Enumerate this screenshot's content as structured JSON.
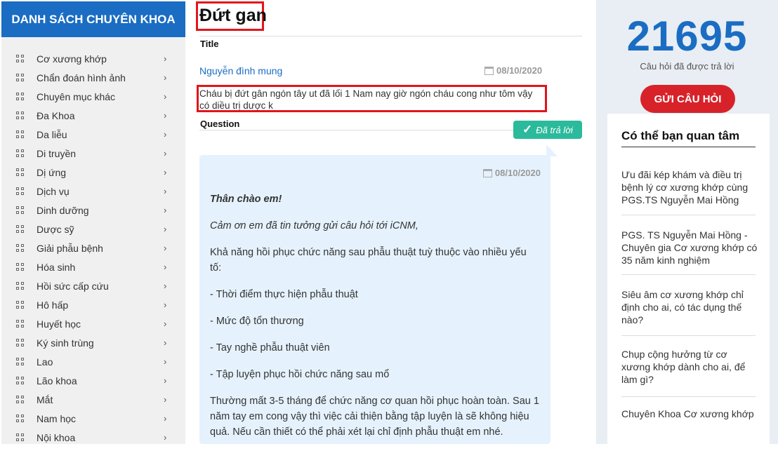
{
  "sidebar": {
    "title": "DANH SÁCH CHUYÊN KHOA",
    "items": [
      "Cơ xương khớp",
      "Chẩn đoán hình ảnh",
      "Chuyên mục khác",
      "Đa Khoa",
      "Da liễu",
      "Di truyền",
      "Dị ứng",
      "Dịch vụ",
      "Dinh dưỡng",
      "Dược sỹ",
      "Giải phẫu bệnh",
      "Hóa sinh",
      "Hồi sức cấp cứu",
      "Hô hấp",
      "Huyết học",
      "Ký sinh trùng",
      "Lao",
      "Lão khoa",
      "Mắt",
      "Nam học",
      "Nội khoa"
    ]
  },
  "question": {
    "title": "Đứt gan",
    "title_tag": "Title",
    "author": "Nguyễn đình mung",
    "date": "08/10/2020",
    "text": "Cháu bị đứt gân ngón tây ut đã lối 1 Nam nay giờ ngón cháu cong như tôm vậy có diều trị dược k",
    "question_tag": "Question",
    "status": "Đã trả lời"
  },
  "answer": {
    "date": "08/10/2020",
    "greeting": "Thân chào em!",
    "thanks": "Cảm ơn em đã tin tưởng gửi câu hỏi tới iCNM,",
    "paragraphs": [
      "Khả năng hồi phục chức năng sau phẫu thuật tuỳ thuộc vào nhiều yếu tố:",
      "- Thời điểm thực hiện phẫu thuật",
      "- Mức độ tổn thương",
      "- Tay nghề phẫu thuật viên",
      "- Tập luyện phục hồi chức năng sau mổ",
      "Thường mất 3-5 tháng để chức năng cơ quan hồi phục hoàn toàn. Sau 1 năm tay em cong vậy thì việc cải thiện bằng tập luyện là sẽ không hiệu quả. Nếu cần thiết có thể phải xét lại chỉ định phẫu thuật em nhé."
    ]
  },
  "stats": {
    "count": "21695",
    "label": "Câu hỏi đã được trả lời",
    "ask_button": "GỬI CÂU HỎI"
  },
  "related": {
    "title": "Có thể bạn quan tâm",
    "items": [
      "Ưu đãi kép khám và điều trị bệnh lý cơ xương khớp cùng PGS.TS Nguyễn Mai Hồng",
      "PGS. TS Nguyễn Mai Hồng - Chuyên gia Cơ xương khớp có 35 năm kinh nghiệm",
      "Siêu âm cơ xương khớp chỉ định cho ai, có tác dụng thế nào?",
      "Chụp cộng hưởng từ cơ xương khớp dành cho ai, để làm gì?",
      "Chuyên Khoa Cơ xương khớp"
    ]
  },
  "colors": {
    "brand_blue": "#1a6dc3",
    "highlight_red": "#e2151b",
    "answered_green": "#2bba9b",
    "ask_red": "#d8222a"
  }
}
